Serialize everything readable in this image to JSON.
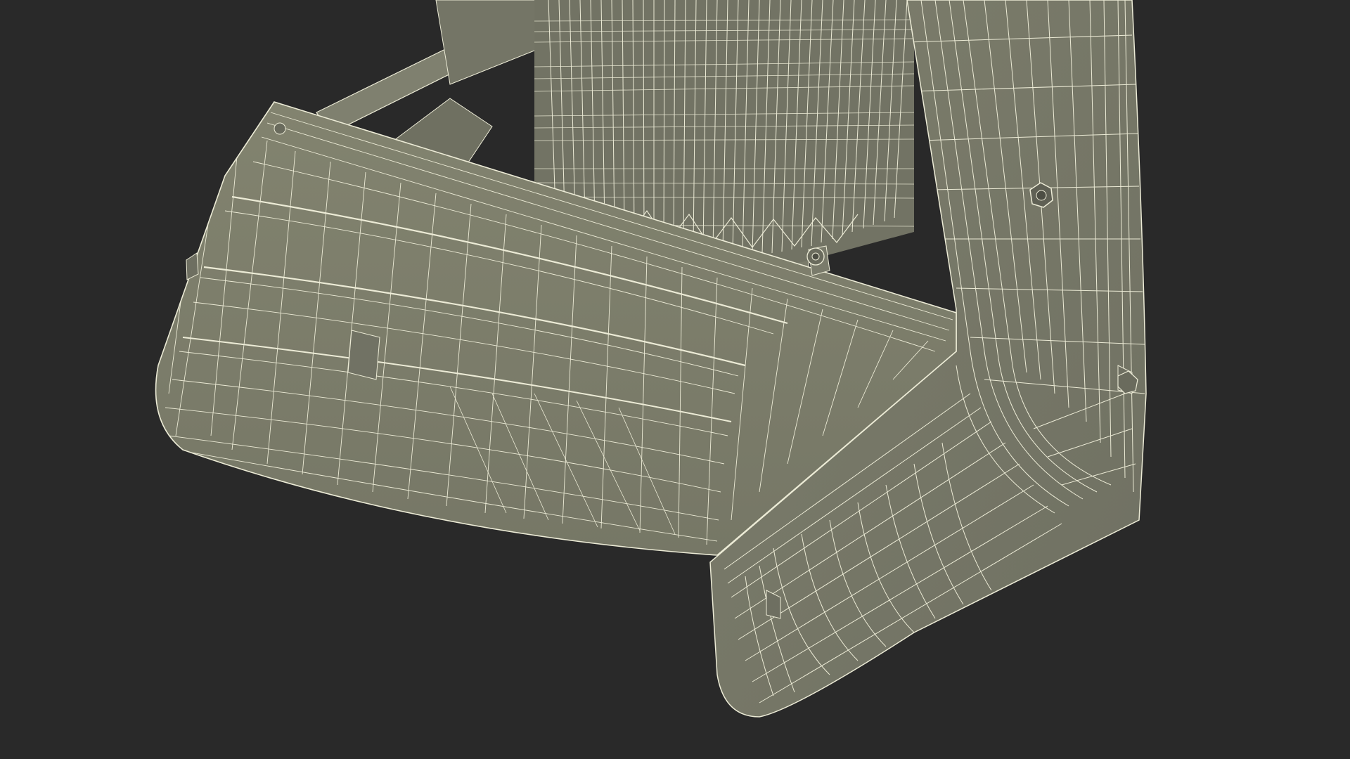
{
  "scene": {
    "background_color": "#292929",
    "surface_color": "#7a7b6c",
    "surface_shade_color": "#6c6d5f",
    "surface_light_color": "#8a8b7b",
    "wire_color": "#ecebd6",
    "subject": "wireframe-3d-model"
  }
}
